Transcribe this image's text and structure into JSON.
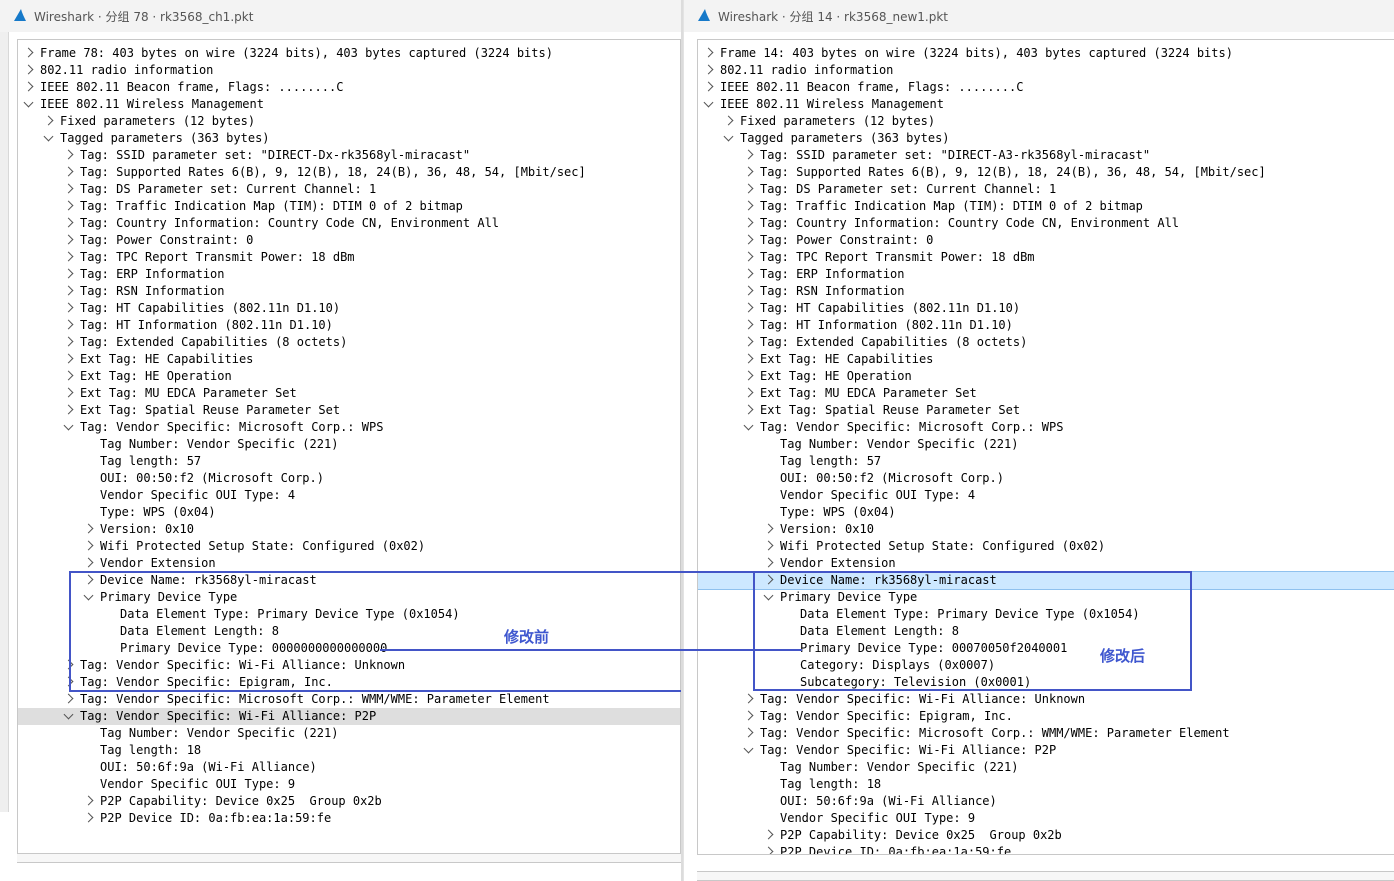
{
  "left": {
    "title": "Wireshark · 分组 78 · rk3568_ch1.pkt",
    "rows": [
      {
        "indent": 0,
        "arrow": "collapsed",
        "text": "Frame 78: 403 bytes on wire (3224 bits), 403 bytes captured (3224 bits)"
      },
      {
        "indent": 0,
        "arrow": "collapsed",
        "text": "802.11 radio information"
      },
      {
        "indent": 0,
        "arrow": "collapsed",
        "text": "IEEE 802.11 Beacon frame, Flags: ........C"
      },
      {
        "indent": 0,
        "arrow": "expanded",
        "text": "IEEE 802.11 Wireless Management"
      },
      {
        "indent": 1,
        "arrow": "collapsed",
        "text": "Fixed parameters (12 bytes)"
      },
      {
        "indent": 1,
        "arrow": "expanded",
        "text": "Tagged parameters (363 bytes)"
      },
      {
        "indent": 2,
        "arrow": "collapsed",
        "text": "Tag: SSID parameter set: \"DIRECT-Dx-rk3568yl-miracast\""
      },
      {
        "indent": 2,
        "arrow": "collapsed",
        "text": "Tag: Supported Rates 6(B), 9, 12(B), 18, 24(B), 36, 48, 54, [Mbit/sec]"
      },
      {
        "indent": 2,
        "arrow": "collapsed",
        "text": "Tag: DS Parameter set: Current Channel: 1"
      },
      {
        "indent": 2,
        "arrow": "collapsed",
        "text": "Tag: Traffic Indication Map (TIM): DTIM 0 of 2 bitmap"
      },
      {
        "indent": 2,
        "arrow": "collapsed",
        "text": "Tag: Country Information: Country Code CN, Environment All"
      },
      {
        "indent": 2,
        "arrow": "collapsed",
        "text": "Tag: Power Constraint: 0"
      },
      {
        "indent": 2,
        "arrow": "collapsed",
        "text": "Tag: TPC Report Transmit Power: 18 dBm"
      },
      {
        "indent": 2,
        "arrow": "collapsed",
        "text": "Tag: ERP Information"
      },
      {
        "indent": 2,
        "arrow": "collapsed",
        "text": "Tag: RSN Information"
      },
      {
        "indent": 2,
        "arrow": "collapsed",
        "text": "Tag: HT Capabilities (802.11n D1.10)"
      },
      {
        "indent": 2,
        "arrow": "collapsed",
        "text": "Tag: HT Information (802.11n D1.10)"
      },
      {
        "indent": 2,
        "arrow": "collapsed",
        "text": "Tag: Extended Capabilities (8 octets)"
      },
      {
        "indent": 2,
        "arrow": "collapsed",
        "text": "Ext Tag: HE Capabilities"
      },
      {
        "indent": 2,
        "arrow": "collapsed",
        "text": "Ext Tag: HE Operation"
      },
      {
        "indent": 2,
        "arrow": "collapsed",
        "text": "Ext Tag: MU EDCA Parameter Set"
      },
      {
        "indent": 2,
        "arrow": "collapsed",
        "text": "Ext Tag: Spatial Reuse Parameter Set"
      },
      {
        "indent": 2,
        "arrow": "expanded",
        "text": "Tag: Vendor Specific: Microsoft Corp.: WPS"
      },
      {
        "indent": 3,
        "arrow": "none",
        "text": "Tag Number: Vendor Specific (221)"
      },
      {
        "indent": 3,
        "arrow": "none",
        "text": "Tag length: 57"
      },
      {
        "indent": 3,
        "arrow": "none",
        "text": "OUI: 00:50:f2 (Microsoft Corp.)"
      },
      {
        "indent": 3,
        "arrow": "none",
        "text": "Vendor Specific OUI Type: 4"
      },
      {
        "indent": 3,
        "arrow": "none",
        "text": "Type: WPS (0x04)"
      },
      {
        "indent": 3,
        "arrow": "collapsed",
        "text": "Version: 0x10"
      },
      {
        "indent": 3,
        "arrow": "collapsed",
        "text": "Wifi Protected Setup State: Configured (0x02)"
      },
      {
        "indent": 3,
        "arrow": "collapsed",
        "text": "Vendor Extension"
      },
      {
        "indent": 3,
        "arrow": "collapsed",
        "text": "Device Name: rk3568yl-miracast"
      },
      {
        "indent": 3,
        "arrow": "expanded",
        "text": "Primary Device Type"
      },
      {
        "indent": 4,
        "arrow": "none",
        "text": "Data Element Type: Primary Device Type (0x1054)"
      },
      {
        "indent": 4,
        "arrow": "none",
        "text": "Data Element Length: 8"
      },
      {
        "indent": 4,
        "arrow": "none",
        "text": "Primary Device Type: 0000000000000000"
      },
      {
        "indent": 2,
        "arrow": "collapsed",
        "text": "Tag: Vendor Specific: Wi-Fi Alliance: Unknown"
      },
      {
        "indent": 2,
        "arrow": "collapsed",
        "text": "Tag: Vendor Specific: Epigram, Inc."
      },
      {
        "indent": 2,
        "arrow": "collapsed",
        "text": "Tag: Vendor Specific: Microsoft Corp.: WMM/WME: Parameter Element"
      },
      {
        "indent": 2,
        "arrow": "expanded",
        "text": "Tag: Vendor Specific: Wi-Fi Alliance: P2P",
        "selected": true
      },
      {
        "indent": 3,
        "arrow": "none",
        "text": "Tag Number: Vendor Specific (221)"
      },
      {
        "indent": 3,
        "arrow": "none",
        "text": "Tag length: 18"
      },
      {
        "indent": 3,
        "arrow": "none",
        "text": "OUI: 50:6f:9a (Wi-Fi Alliance)"
      },
      {
        "indent": 3,
        "arrow": "none",
        "text": "Vendor Specific OUI Type: 9"
      },
      {
        "indent": 3,
        "arrow": "collapsed",
        "text": "P2P Capability: Device 0x25  Group 0x2b"
      },
      {
        "indent": 3,
        "arrow": "collapsed",
        "text": "P2P Device ID: 0a:fb:ea:1a:59:fe"
      }
    ]
  },
  "right": {
    "title": "Wireshark · 分组 14 · rk3568_new1.pkt",
    "rows": [
      {
        "indent": 0,
        "arrow": "collapsed",
        "text": "Frame 14: 403 bytes on wire (3224 bits), 403 bytes captured (3224 bits)"
      },
      {
        "indent": 0,
        "arrow": "collapsed",
        "text": "802.11 radio information"
      },
      {
        "indent": 0,
        "arrow": "collapsed",
        "text": "IEEE 802.11 Beacon frame, Flags: ........C"
      },
      {
        "indent": 0,
        "arrow": "expanded",
        "text": "IEEE 802.11 Wireless Management"
      },
      {
        "indent": 1,
        "arrow": "collapsed",
        "text": "Fixed parameters (12 bytes)"
      },
      {
        "indent": 1,
        "arrow": "expanded",
        "text": "Tagged parameters (363 bytes)"
      },
      {
        "indent": 2,
        "arrow": "collapsed",
        "text": "Tag: SSID parameter set: \"DIRECT-A3-rk3568yl-miracast\""
      },
      {
        "indent": 2,
        "arrow": "collapsed",
        "text": "Tag: Supported Rates 6(B), 9, 12(B), 18, 24(B), 36, 48, 54, [Mbit/sec]"
      },
      {
        "indent": 2,
        "arrow": "collapsed",
        "text": "Tag: DS Parameter set: Current Channel: 1"
      },
      {
        "indent": 2,
        "arrow": "collapsed",
        "text": "Tag: Traffic Indication Map (TIM): DTIM 0 of 2 bitmap"
      },
      {
        "indent": 2,
        "arrow": "collapsed",
        "text": "Tag: Country Information: Country Code CN, Environment All"
      },
      {
        "indent": 2,
        "arrow": "collapsed",
        "text": "Tag: Power Constraint: 0"
      },
      {
        "indent": 2,
        "arrow": "collapsed",
        "text": "Tag: TPC Report Transmit Power: 18 dBm"
      },
      {
        "indent": 2,
        "arrow": "collapsed",
        "text": "Tag: ERP Information"
      },
      {
        "indent": 2,
        "arrow": "collapsed",
        "text": "Tag: RSN Information"
      },
      {
        "indent": 2,
        "arrow": "collapsed",
        "text": "Tag: HT Capabilities (802.11n D1.10)"
      },
      {
        "indent": 2,
        "arrow": "collapsed",
        "text": "Tag: HT Information (802.11n D1.10)"
      },
      {
        "indent": 2,
        "arrow": "collapsed",
        "text": "Tag: Extended Capabilities (8 octets)"
      },
      {
        "indent": 2,
        "arrow": "collapsed",
        "text": "Ext Tag: HE Capabilities"
      },
      {
        "indent": 2,
        "arrow": "collapsed",
        "text": "Ext Tag: HE Operation"
      },
      {
        "indent": 2,
        "arrow": "collapsed",
        "text": "Ext Tag: MU EDCA Parameter Set"
      },
      {
        "indent": 2,
        "arrow": "collapsed",
        "text": "Ext Tag: Spatial Reuse Parameter Set"
      },
      {
        "indent": 2,
        "arrow": "expanded",
        "text": "Tag: Vendor Specific: Microsoft Corp.: WPS"
      },
      {
        "indent": 3,
        "arrow": "none",
        "text": "Tag Number: Vendor Specific (221)"
      },
      {
        "indent": 3,
        "arrow": "none",
        "text": "Tag length: 57"
      },
      {
        "indent": 3,
        "arrow": "none",
        "text": "OUI: 00:50:f2 (Microsoft Corp.)"
      },
      {
        "indent": 3,
        "arrow": "none",
        "text": "Vendor Specific OUI Type: 4"
      },
      {
        "indent": 3,
        "arrow": "none",
        "text": "Type: WPS (0x04)"
      },
      {
        "indent": 3,
        "arrow": "collapsed",
        "text": "Version: 0x10"
      },
      {
        "indent": 3,
        "arrow": "collapsed",
        "text": "Wifi Protected Setup State: Configured (0x02)"
      },
      {
        "indent": 3,
        "arrow": "collapsed",
        "text": "Vendor Extension"
      },
      {
        "indent": 3,
        "arrow": "collapsed",
        "text": "Device Name: rk3568yl-miracast",
        "highlight": true
      },
      {
        "indent": 3,
        "arrow": "expanded",
        "text": "Primary Device Type"
      },
      {
        "indent": 4,
        "arrow": "none",
        "text": "Data Element Type: Primary Device Type (0x1054)"
      },
      {
        "indent": 4,
        "arrow": "none",
        "text": "Data Element Length: 8"
      },
      {
        "indent": 4,
        "arrow": "none",
        "text": "Primary Device Type: 00070050f2040001"
      },
      {
        "indent": 4,
        "arrow": "none",
        "text": "Category: Displays (0x0007)"
      },
      {
        "indent": 4,
        "arrow": "none",
        "text": "Subcategory: Television (0x0001)"
      },
      {
        "indent": 2,
        "arrow": "collapsed",
        "text": "Tag: Vendor Specific: Wi-Fi Alliance: Unknown"
      },
      {
        "indent": 2,
        "arrow": "collapsed",
        "text": "Tag: Vendor Specific: Epigram, Inc."
      },
      {
        "indent": 2,
        "arrow": "collapsed",
        "text": "Tag: Vendor Specific: Microsoft Corp.: WMM/WME: Parameter Element"
      },
      {
        "indent": 2,
        "arrow": "expanded",
        "text": "Tag: Vendor Specific: Wi-Fi Alliance: P2P"
      },
      {
        "indent": 3,
        "arrow": "none",
        "text": "Tag Number: Vendor Specific (221)"
      },
      {
        "indent": 3,
        "arrow": "none",
        "text": "Tag length: 18"
      },
      {
        "indent": 3,
        "arrow": "none",
        "text": "OUI: 50:6f:9a (Wi-Fi Alliance)"
      },
      {
        "indent": 3,
        "arrow": "none",
        "text": "Vendor Specific OUI Type: 9"
      },
      {
        "indent": 3,
        "arrow": "collapsed",
        "text": "P2P Capability: Device 0x25  Group 0x2b"
      },
      {
        "indent": 3,
        "arrow": "collapsed",
        "text": "P2P Device ID: 0a:fb:ea:1a:59:fe"
      }
    ]
  },
  "annotations": {
    "before_label": "修改前",
    "after_label": "修改后",
    "color": "#4355c7"
  }
}
